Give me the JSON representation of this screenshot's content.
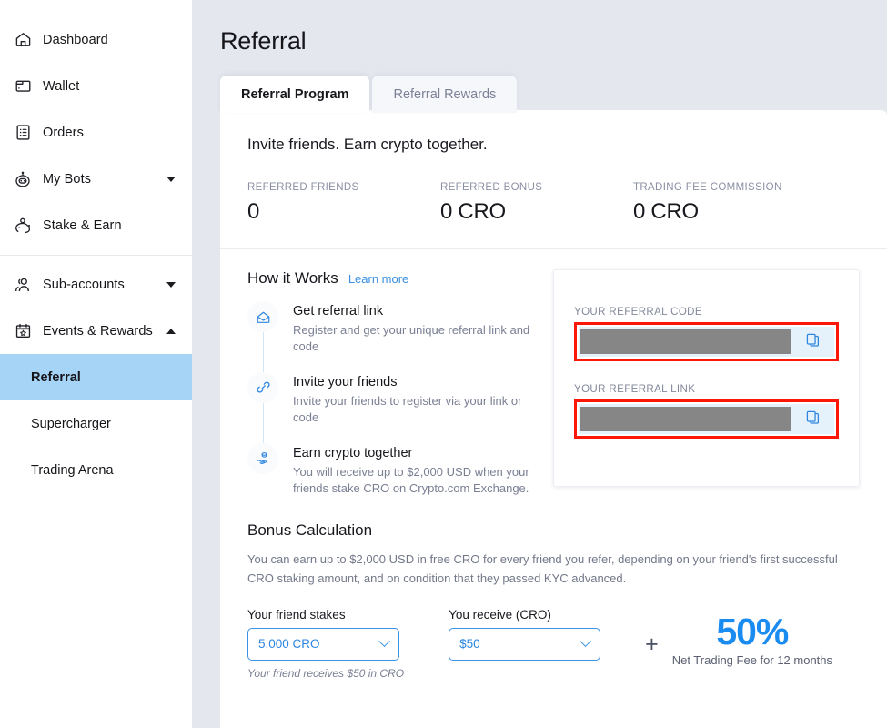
{
  "sidebar": {
    "items": [
      {
        "label": "Dashboard",
        "icon": "home-icon",
        "expandable": false
      },
      {
        "label": "Wallet",
        "icon": "wallet-icon",
        "expandable": false
      },
      {
        "label": "Orders",
        "icon": "orders-list-icon",
        "expandable": false
      },
      {
        "label": "My Bots",
        "icon": "robot-icon",
        "expandable": true,
        "caret": "down"
      },
      {
        "label": "Stake & Earn",
        "icon": "piggy-bank-icon",
        "expandable": false
      },
      {
        "label": "Sub-accounts",
        "icon": "users-icon",
        "expandable": true,
        "caret": "down"
      },
      {
        "label": "Events & Rewards",
        "icon": "calendar-star-icon",
        "expandable": true,
        "caret": "up"
      }
    ],
    "sub_items": [
      {
        "label": "Referral",
        "active": true
      },
      {
        "label": "Supercharger",
        "active": false
      },
      {
        "label": "Trading Arena",
        "active": false
      }
    ]
  },
  "header": {
    "title": "Referral"
  },
  "tabs": [
    {
      "label": "Referral Program",
      "active": true
    },
    {
      "label": "Referral Rewards",
      "active": false
    }
  ],
  "main": {
    "headline": "Invite friends. Earn crypto together.",
    "stats": [
      {
        "label": "REFERRED FRIENDS",
        "value": "0"
      },
      {
        "label": "REFERRED BONUS",
        "value": "0 CRO"
      },
      {
        "label": "TRADING FEE COMMISSION",
        "value": "0 CRO"
      }
    ],
    "how_it_works": {
      "title": "How it Works",
      "learn_more": "Learn more",
      "steps": [
        {
          "icon": "open-envelope-icon",
          "title": "Get referral link",
          "desc": "Register and get your unique referral link and code"
        },
        {
          "icon": "link-chain-icon",
          "title": "Invite your friends",
          "desc": "Invite your friends to register via your link or code"
        },
        {
          "icon": "hand-coins-icon",
          "title": "Earn crypto together",
          "desc": "You will receive up to $2,000 USD when your friends stake CRO on Crypto.com Exchange."
        }
      ]
    },
    "referral_card": {
      "code_label": "YOUR REFERRAL CODE",
      "code_value": "",
      "link_label": "YOUR REFERRAL LINK",
      "link_value": "",
      "copy_icon": "copy-icon",
      "redacted": true,
      "highlight_color": "#fc1708"
    },
    "bonus": {
      "title": "Bonus Calculation",
      "desc": "You can earn up to $2,000 USD in free CRO for every friend you refer, depending on your friend's first successful CRO staking amount, and on condition that they passed KYC advanced.",
      "stake_label": "Your friend stakes",
      "stake_value": "5,000 CRO",
      "receive_label": "You receive (CRO)",
      "receive_value": "$50",
      "note": "Your friend receives $50 in CRO",
      "plus": "+",
      "percent": "50%",
      "percent_sub": "Net Trading Fee for 12 months"
    }
  },
  "colors": {
    "accent_blue": "#1a8bf0",
    "link_blue": "#3a8fe0",
    "active_nav": "#a6d4f7",
    "page_bg": "#e5e7ef",
    "redaction": "#868686",
    "highlight": "#fc1708"
  }
}
